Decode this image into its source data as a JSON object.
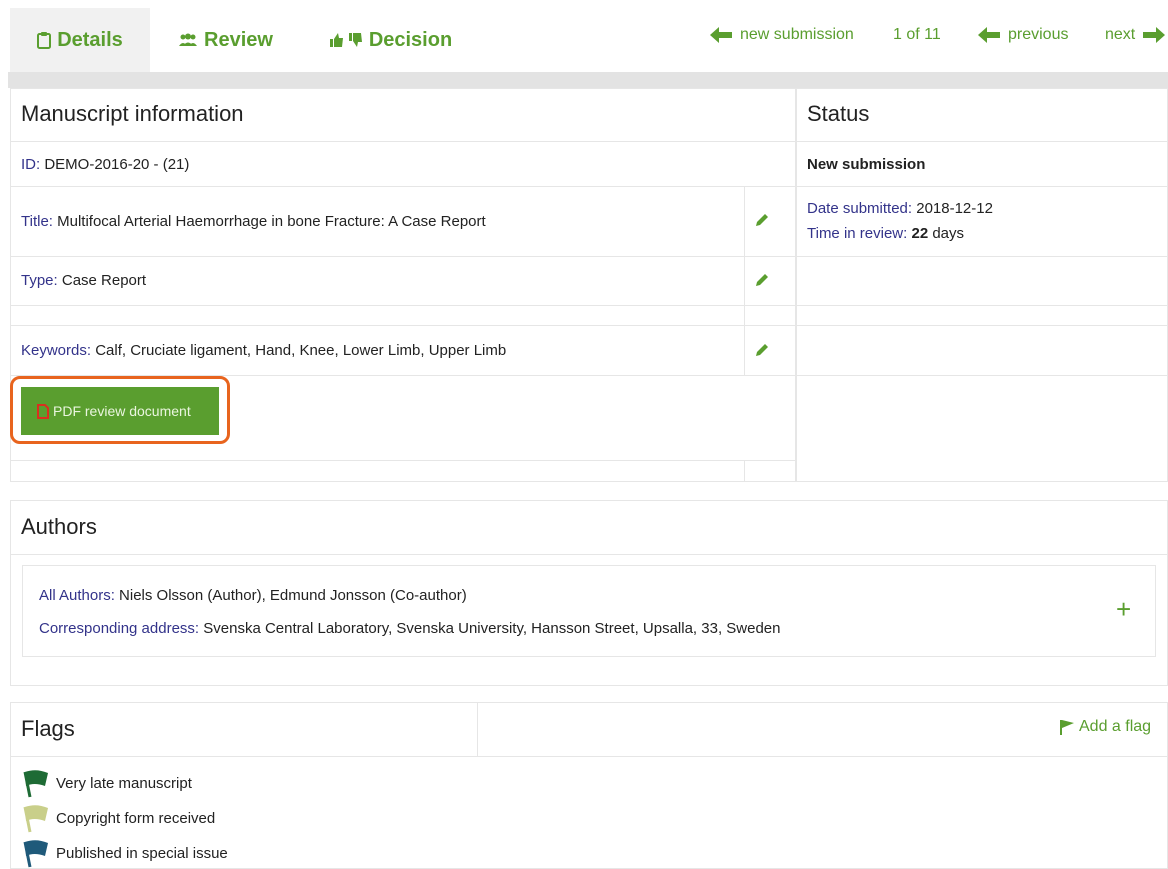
{
  "tabs": [
    {
      "label": "Details",
      "icon": "clipboard-icon"
    },
    {
      "label": "Review",
      "icon": "users-icon"
    },
    {
      "label": "Decision",
      "icon": "thumbs-up-down-icon"
    }
  ],
  "nav": {
    "new_submission": "new submission",
    "counter": "1 of 11",
    "previous": "previous",
    "next": "next"
  },
  "manuscript": {
    "title": "Manuscript information",
    "id_label": "ID:",
    "id_value": " DEMO-2016-20 - (21)",
    "title_label": "Title:",
    "title_value": " Multifocal Arterial Haemorrhage in bone Fracture: A Case Report",
    "type_label": "Type:",
    "type_value": " Case Report",
    "keywords_label": "Keywords:",
    "keywords_value": " Calf, Cruciate ligament, Hand, Knee, Lower Limb, Upper Limb",
    "pdf_button": "PDF review document"
  },
  "status": {
    "title": "Status",
    "state": "New submission",
    "date_label": "Date submitted:",
    "date_value": " 2018-12-12",
    "time_label": "Time in review:",
    "time_value": "22",
    "time_unit": " days"
  },
  "authors": {
    "title": "Authors",
    "all_label": "All Authors:",
    "all_value": " Niels Olsson (Author), Edmund Jonsson (Co-author)",
    "address_label": "Corresponding address:",
    "address_value": " Svenska Central Laboratory, Svenska University, Hansson Street, Upsalla, 33, Sweden",
    "add_symbol": "+"
  },
  "flags": {
    "title": "Flags",
    "add_label": "Add a flag",
    "items": [
      {
        "label": "Very late manuscript",
        "color": "#1e6b35"
      },
      {
        "label": "Copyright form received",
        "color": "#c9cf8a"
      },
      {
        "label": "Published in special issue",
        "color": "#1f5a7a"
      }
    ]
  },
  "colors": {
    "accent": "#5a9e2f",
    "label": "#33338a",
    "highlight": "#e8641e"
  }
}
